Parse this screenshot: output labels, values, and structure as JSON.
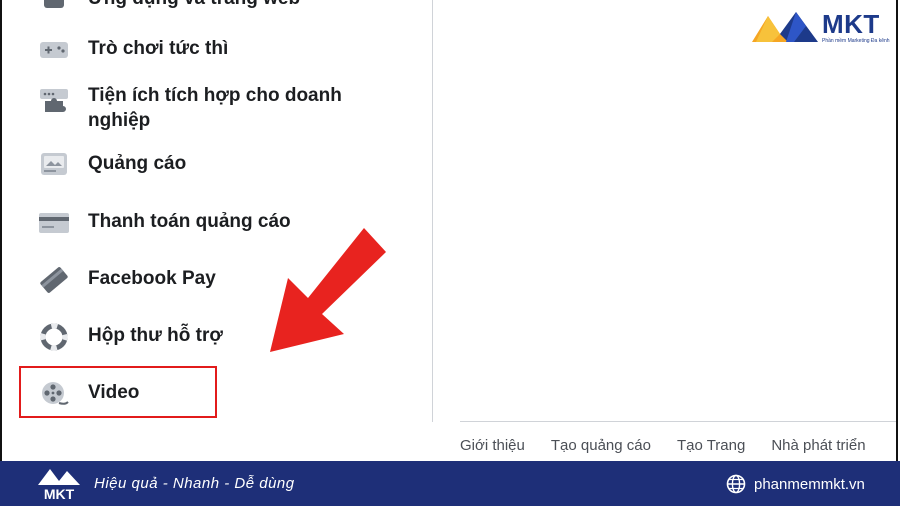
{
  "menu": {
    "items": [
      {
        "label": "Ứng dụng và trang web",
        "icon": "apps-icon"
      },
      {
        "label": "Trò chơi tức thì",
        "icon": "gamepad-icon"
      },
      {
        "label": "Tiện ích tích hợp cho doanh nghiệp",
        "icon": "puzzle-icon"
      },
      {
        "label": "Quảng cáo",
        "icon": "ads-icon"
      },
      {
        "label": "Thanh toán quảng cáo",
        "icon": "credit-card-icon"
      },
      {
        "label": "Facebook Pay",
        "icon": "payment-card-icon"
      },
      {
        "label": "Hộp thư hỗ trợ",
        "icon": "lifebuoy-icon"
      },
      {
        "label": "Video",
        "icon": "film-reel-icon"
      }
    ]
  },
  "footer": {
    "links": [
      "Giới thiệu",
      "Tạo quảng cáo",
      "Tạo Trang",
      "Nhà phát triển"
    ]
  },
  "logo": {
    "text": "MKT",
    "subtitle": "Phần mềm Marketing Đa kênh"
  },
  "banner": {
    "tagline": "Hiệu quả - Nhanh - Dễ dùng",
    "website": "phanmemmkt.vn"
  },
  "colors": {
    "highlight": "#e21b1b",
    "arrow": "#e8231f",
    "banner_bg": "#1e2f78",
    "text": "#1c1e21"
  }
}
